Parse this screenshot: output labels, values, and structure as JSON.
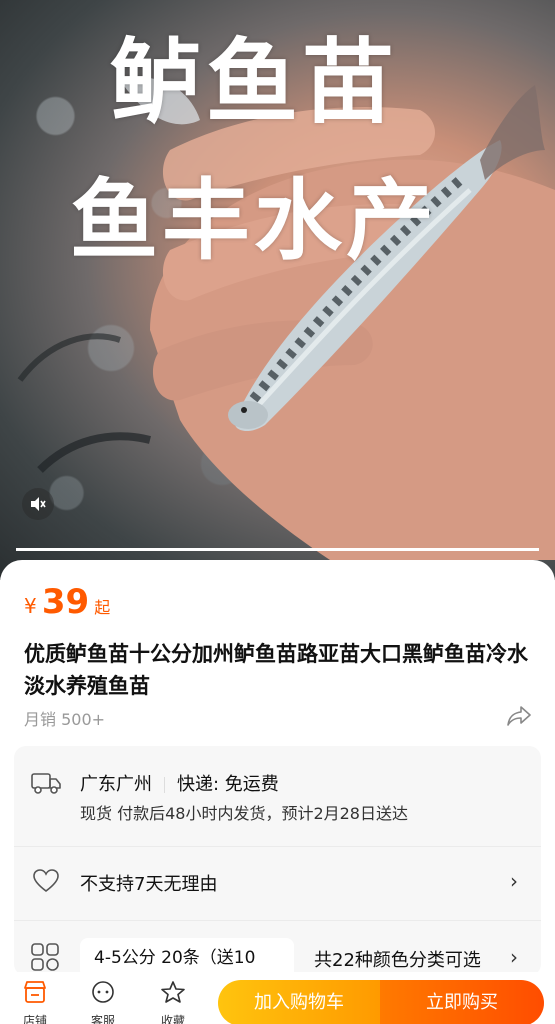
{
  "hero": {
    "overlay_line1": "鲈鱼苗",
    "overlay_line2": "鱼丰水产",
    "video_progress": 1.0,
    "mute_icon": "speaker-muted-icon"
  },
  "product": {
    "currency": "¥",
    "price": "39",
    "price_suffix": "起",
    "title": "优质鲈鱼苗十公分加州鲈鱼苗路亚苗大口黑鲈鱼苗冷水淡水养殖鱼苗",
    "monthly_sales": "月销 500+",
    "share_icon": "share-icon"
  },
  "shipping": {
    "origin": "广东广州",
    "method": "快递: 免运费",
    "detail": "现货 付款后48小时内发货，预计2月28日送达",
    "icon": "truck-icon"
  },
  "returns": {
    "text": "不支持7天无理由",
    "icon": "heart-icon"
  },
  "sku": {
    "selected": "4-5公分 20条（送10",
    "options_summary": "共22种颜色分类可选",
    "icon": "grid-icon"
  },
  "bottom_bar": {
    "shop_label": "店铺",
    "service_label": "客服",
    "favorite_label": "收藏",
    "add_to_cart": "加入购物车",
    "buy_now": "立即购买"
  },
  "colors": {
    "price": "#ff5a00",
    "cart_gradient": [
      "#ffc40e",
      "#ff9a00"
    ],
    "buy_gradient": [
      "#ff7a00",
      "#ff4d00"
    ]
  }
}
